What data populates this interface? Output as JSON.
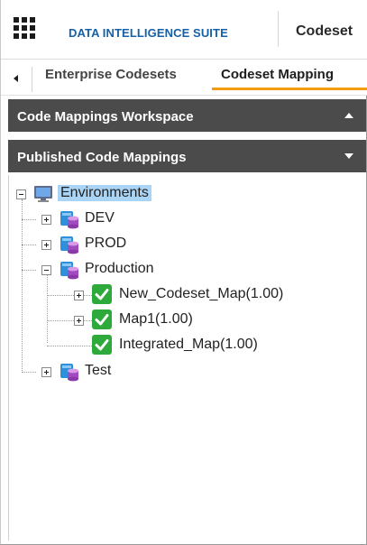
{
  "header": {
    "app_title": "DATA INTELLIGENCE SUITE",
    "module_title": "Codeset",
    "app_menu_icon": "grid-menu-icon"
  },
  "tabs": [
    {
      "label": "Enterprise Codesets",
      "active": false
    },
    {
      "label": "Codeset Mapping",
      "active": true
    }
  ],
  "sections": {
    "workspace": {
      "title": "Code Mappings Workspace",
      "state": "collapsed"
    },
    "published": {
      "title": "Published Code Mappings",
      "state": "expanded"
    }
  },
  "tree": {
    "root": {
      "label": "Environments",
      "icon": "computer-icon",
      "selected": true
    },
    "environments": [
      {
        "label": "DEV",
        "icon": "database-icon",
        "expanded": false
      },
      {
        "label": "PROD",
        "icon": "database-icon",
        "expanded": false
      },
      {
        "label": "Production",
        "icon": "database-icon",
        "expanded": true,
        "children": [
          {
            "label": "New_Codeset_Map(1.00)",
            "icon": "green-check-icon",
            "expandable": true
          },
          {
            "label": "Map1(1.00)",
            "icon": "green-check-icon",
            "expandable": true
          },
          {
            "label": "Integrated_Map(1.00)",
            "icon": "green-check-icon",
            "expandable": false
          }
        ]
      },
      {
        "label": "Test",
        "icon": "database-icon",
        "expanded": false
      }
    ]
  },
  "colors": {
    "brand_blue": "#1560a8",
    "active_tab_accent": "#f39c12",
    "section_header_bg": "#4b4b4b",
    "selected_bg": "#a9d4f5",
    "check_green": "#2eaa3c"
  }
}
